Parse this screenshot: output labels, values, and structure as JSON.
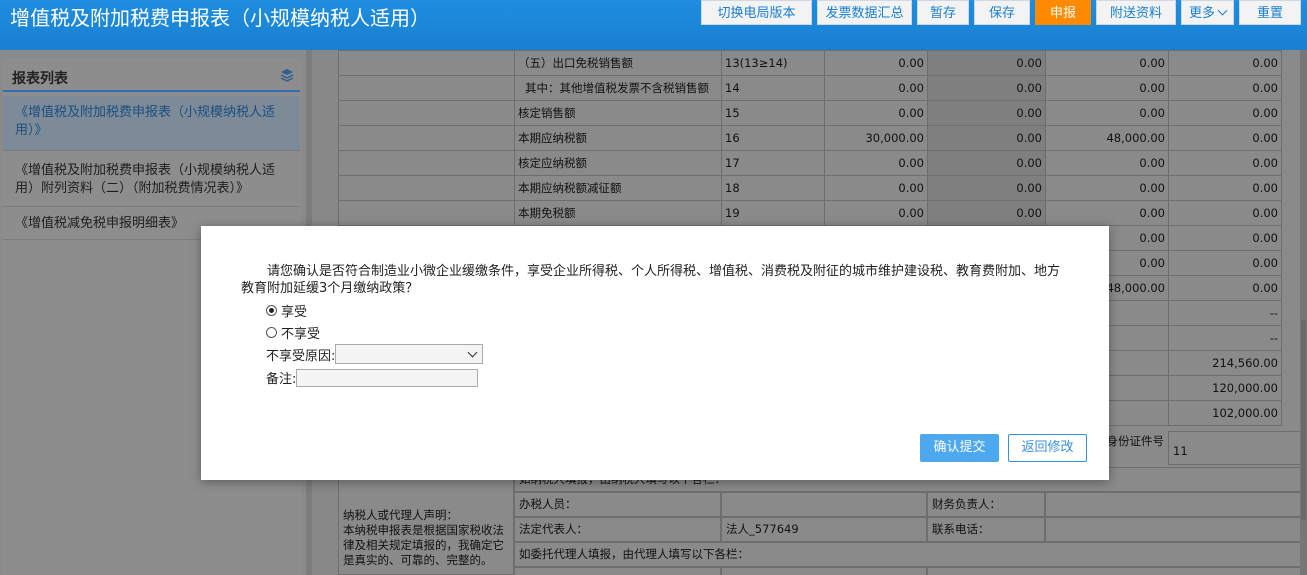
{
  "header": {
    "title": "增值税及附加税费申报表（小规模纳税人适用）",
    "buttons": [
      "切换电局版本",
      "发票数据汇总",
      "暂存",
      "保存",
      "申报",
      "附送资料",
      "更多",
      "重置"
    ],
    "active_button": "申报"
  },
  "sidebar": {
    "title": "报表列表",
    "items": [
      "《增值税及附加税费申报表（小规模纳税人适用）》",
      "《增值税及附加税费申报表（小规模纳税人适用）附列资料（二）（附加税费情况表）》",
      "《增值税减免税申报明细表》"
    ]
  },
  "table": {
    "rows": [
      {
        "label": "（五）出口免税销售额",
        "line": "13(13≥14)",
        "v1": "0.00",
        "v2": "0.00",
        "v3": "0.00",
        "v4": "0.00"
      },
      {
        "label": "其中：其他增值税发票不含税销售额",
        "line": "14",
        "v1": "0.00",
        "v2": "0.00",
        "v3": "0.00",
        "v4": "0.00"
      },
      {
        "label": "核定销售额",
        "line": "15",
        "v1": "0.00",
        "v2": "0.00",
        "v3": "0.00",
        "v4": "0.00"
      },
      {
        "label": "本期应纳税额",
        "line": "16",
        "v1": "30,000.00",
        "v2": "0.00",
        "v3": "48,000.00",
        "v4": "0.00"
      },
      {
        "label": "核定应纳税额",
        "line": "17",
        "v1": "0.00",
        "v2": "0.00",
        "v3": "0.00",
        "v4": "0.00"
      },
      {
        "label": "本期应纳税额减征额",
        "line": "18",
        "v1": "0.00",
        "v2": "0.00",
        "v3": "0.00",
        "v4": "0.00"
      },
      {
        "label": "本期免税额",
        "line": "19",
        "v1": "0.00",
        "v2": "0.00",
        "v3": "0.00",
        "v4": "0.00"
      },
      {
        "label": "",
        "line": "",
        "v1": "",
        "v2": "",
        "v3": "0.00",
        "v4": "0.00"
      },
      {
        "label": "",
        "line": "",
        "v1": "",
        "v2": "",
        "v3": "0.00",
        "v4": "0.00"
      },
      {
        "label": "",
        "line": "",
        "v1": "",
        "v2": "",
        "v3": "48,000.00",
        "v4": "0.00"
      },
      {
        "label": "",
        "line": "",
        "v1": "",
        "v2": "",
        "v3": "",
        "v4": "--"
      },
      {
        "label": "",
        "line": "",
        "v1": "",
        "v2": "",
        "v3": "",
        "v4": "--"
      },
      {
        "label": "",
        "line": "",
        "v1": "",
        "v2": "",
        "v3": "",
        "v4": "214,560.00"
      },
      {
        "label": "",
        "line": "",
        "v1": "",
        "v2": "",
        "v3": "",
        "v4": "120,000.00"
      },
      {
        "label": "",
        "line": "",
        "v1": "",
        "v2": "",
        "v3": "",
        "v4": "102,000.00"
      }
    ],
    "id_label": "身份证件号",
    "id_value": "11",
    "self_fill_note": "如纳税人填报，由纳税人填写以下各栏：",
    "declaration_label": "纳税人或代理人声明：",
    "declaration_text": "本纳税申报表是根据国家税收法律及相关规定填报的，我确定它是真实的、可靠的、完整的。",
    "handler_label": "办税人员：",
    "finance_label": "财务负责人：",
    "legal_rep_label": "法定代表人：",
    "legal_rep_value": "法人_577649",
    "phone_label": "联系电话：",
    "agent_note": "如委托代理人填报，由代理人填写以下各栏："
  },
  "modal": {
    "question": "请您确认是否符合制造业小微企业缓缴条件，享受企业所得税、个人所得税、增值税、消费税及附征的城市维护建设税、教育费附加、地方教育附加延缓3个月缴纳政策？",
    "option_yes": "享受",
    "option_no": "不享受",
    "selected": "享受",
    "reason_label": "不享受原因:",
    "reason_value": "",
    "remark_label": "备注:",
    "remark_value": "",
    "confirm_button": "确认提交",
    "back_button": "返回修改"
  }
}
